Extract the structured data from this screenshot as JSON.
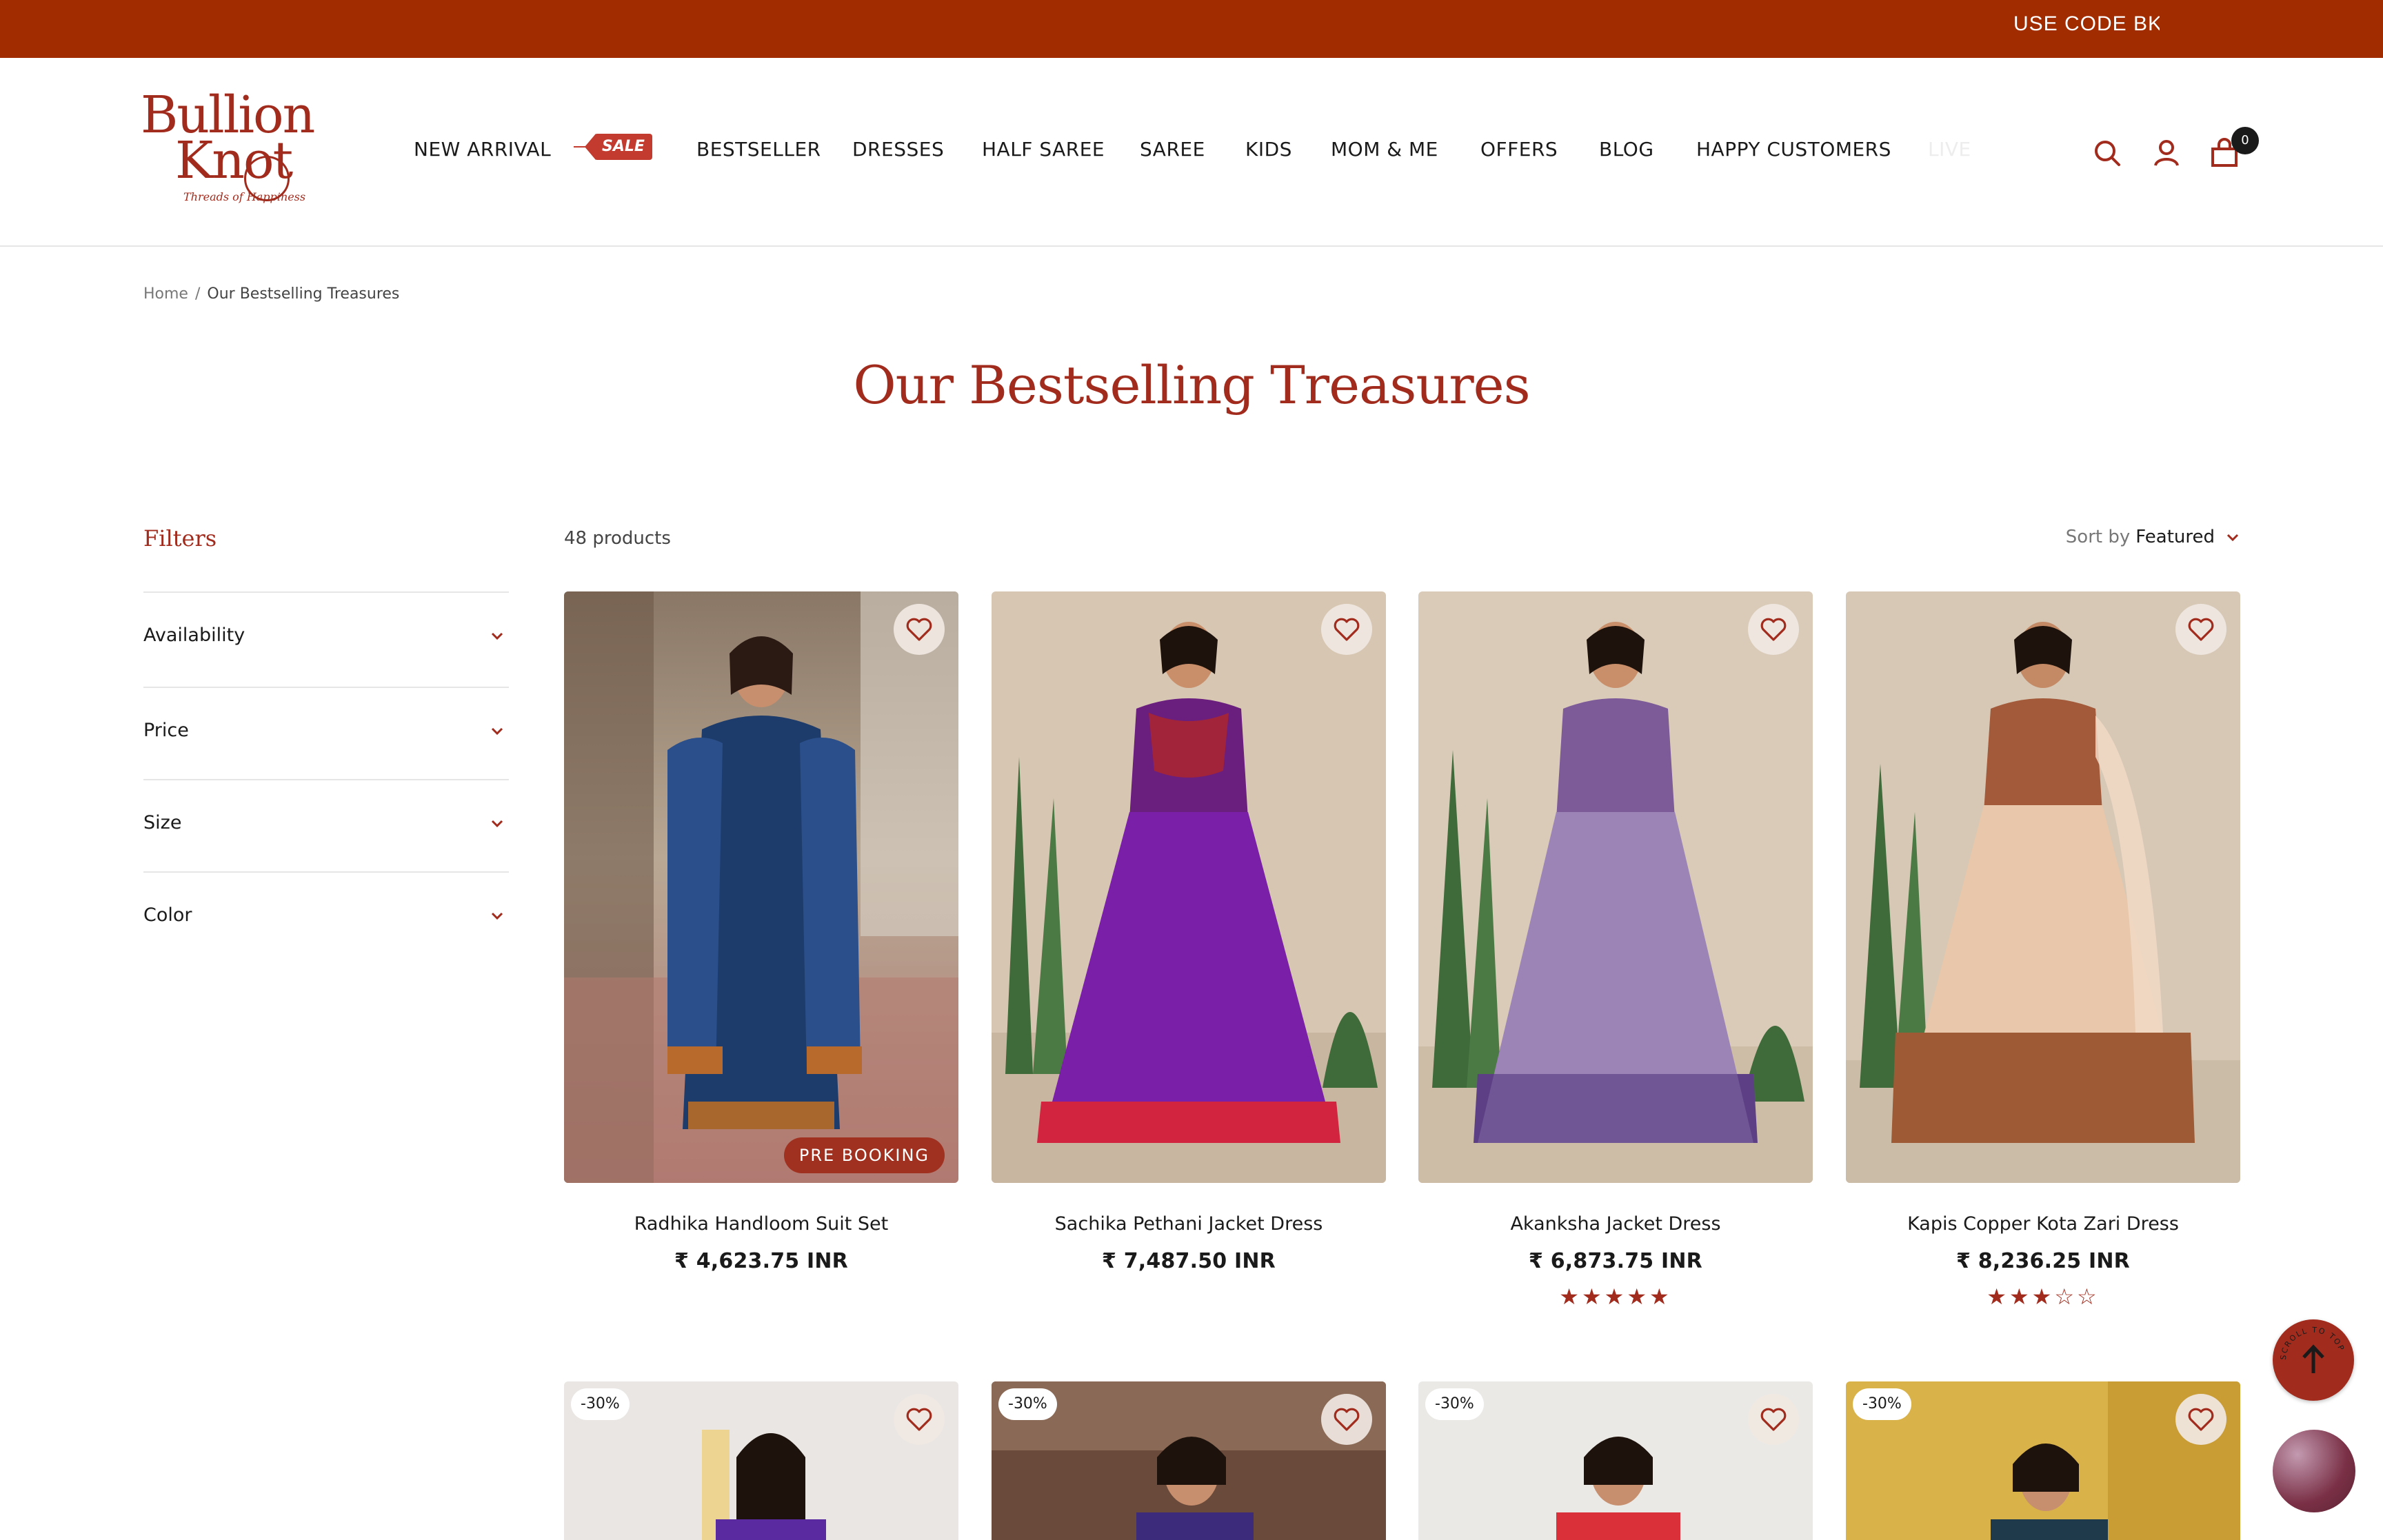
{
  "announcement": {
    "text": "USE CODE BKFI"
  },
  "brand": {
    "name_line1": "Bullion",
    "name_line2": "Knot",
    "tagline": "Threads of Happiness",
    "color": "#a12c1e"
  },
  "nav": {
    "items": [
      "NEW ARRIVAL",
      "SALE",
      "BESTSELLER",
      "DRESSES",
      "HALF SAREE",
      "SAREE",
      "KIDS",
      "MOM & ME",
      "OFFERS",
      "BLOG",
      "HAPPY CUSTOMERS",
      "LIVE"
    ]
  },
  "header_icons": {
    "search": "search-icon",
    "account": "user-icon",
    "cart": "cart-icon",
    "cart_count": "0"
  },
  "breadcrumb": {
    "home": "Home",
    "separator": "/",
    "current": "Our Bestselling Treasures"
  },
  "page_title": "Our Bestselling Treasures",
  "filters": {
    "title": "Filters",
    "groups": [
      "Availability",
      "Price",
      "Size",
      "Color"
    ]
  },
  "listing": {
    "count": "48 products",
    "sort_label": "Sort by",
    "sort_value": "Featured"
  },
  "products": [
    {
      "name": "Radhika Handloom Suit Set",
      "price": "₹ 4,623.75 INR",
      "badge": "PRE BOOKING",
      "rating": null,
      "image": "model in blue handloom suit with dupatta"
    },
    {
      "name": "Sachika Pethani Jacket Dress",
      "price": "₹ 7,487.50 INR",
      "badge": "",
      "rating": null,
      "image": "model in purple silk jacket gown"
    },
    {
      "name": "Akanksha Jacket Dress",
      "price": "₹ 6,873.75 INR",
      "badge": "",
      "rating": 5,
      "image": "model in lavender brocade jacket dress"
    },
    {
      "name": "Kapis Copper Kota Zari Dress",
      "price": "₹ 8,236.25 INR",
      "badge": "",
      "rating": 3,
      "image": "model in copper kota gown with dupatta"
    }
  ],
  "products_row2": [
    {
      "discount": "-30%"
    },
    {
      "discount": "-30%"
    },
    {
      "discount": "-30%"
    },
    {
      "discount": "-30%"
    }
  ],
  "scroll_top": {
    "label": "SCROLL TO TOP"
  }
}
